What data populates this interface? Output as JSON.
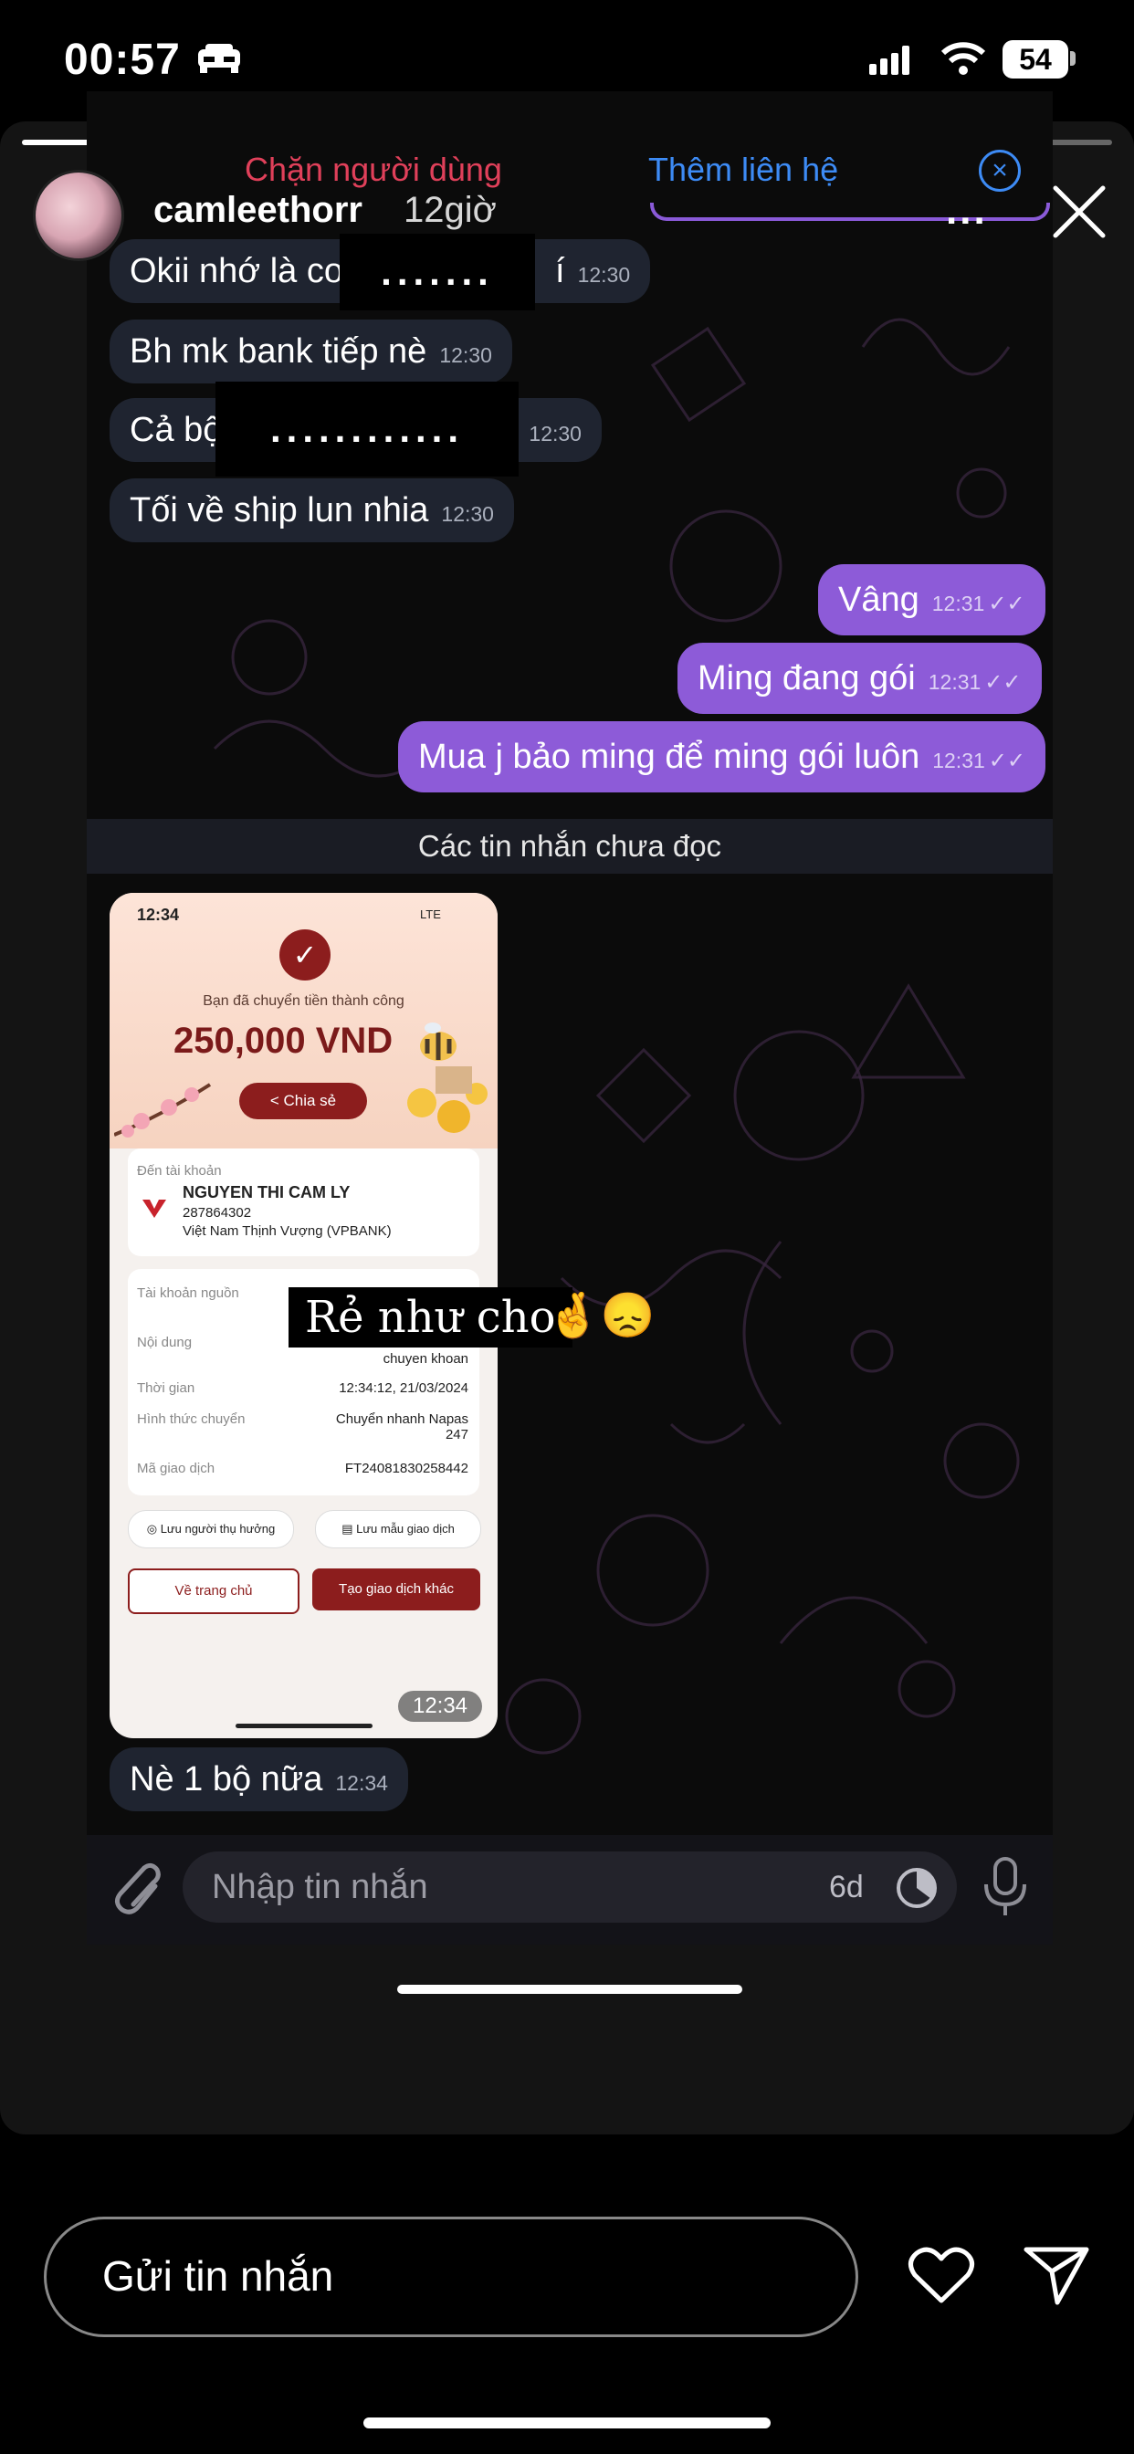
{
  "status_bar": {
    "time": "00:57",
    "battery": "54"
  },
  "story": {
    "username": "camleethorr",
    "age": "12giờ",
    "more_label": "...",
    "reply_placeholder": "Gửi tin nhắn"
  },
  "chat_header": {
    "block_user": "Chặn người dùng",
    "add_contact": "Thêm liên hệ"
  },
  "messages_in": [
    {
      "text": "Okii nhớ là co",
      "tail": "í",
      "time": "12:30",
      "redaction": "......."
    },
    {
      "text": "Bh mk bank tiếp nè",
      "time": "12:30"
    },
    {
      "text": "Cả bộ",
      "time": "12:30",
      "redaction": "............"
    },
    {
      "text": "Tối về ship lun nhia",
      "time": "12:30"
    }
  ],
  "messages_out": [
    {
      "text": "Vâng",
      "time": "12:31"
    },
    {
      "text": "Ming đang gói",
      "time": "12:31"
    },
    {
      "text": "Mua j bảo ming để ming gói luôn",
      "time": "12:31"
    }
  ],
  "unread_divider": "Các tin nhắn chưa đọc",
  "receipt": {
    "status_time": "12:34",
    "network": "LTE",
    "title": "Bạn đã chuyển tiền thành công",
    "amount": "250,000 VND",
    "share": "Chia sẻ",
    "dest_label": "Đến tài khoản",
    "dest_name": "NGUYEN THI CAM LY",
    "dest_account": "287864302",
    "dest_bank": "Việt Nam Thịnh Vượng (VPBANK)",
    "details": [
      {
        "label": "Tài khoản nguồn",
        "value": ""
      },
      {
        "label": "Nội dung",
        "value": "chuyen khoan"
      },
      {
        "label": "Thời gian",
        "value": "12:34:12, 21/03/2024"
      },
      {
        "label": "Hình thức chuyển",
        "value": "Chuyển nhanh Napas 247"
      },
      {
        "label": "Mã giao dịch",
        "value": "FT24081830258442"
      }
    ],
    "save_payee": "Lưu người thụ hưởng",
    "save_template": "Lưu mẫu giao dịch",
    "home": "Về trang chủ",
    "new_transaction": "Tạo giao dịch khác",
    "image_time": "12:34"
  },
  "sticker": {
    "text": "Rẻ như cho",
    "emoji": "🤞😞"
  },
  "last_message": {
    "text": "Nè 1 bộ nữa",
    "time": "12:34"
  },
  "composer": {
    "placeholder": "Nhập tin nhắn",
    "timer": "6d"
  },
  "colors": {
    "accent_purple": "#8d5bd8",
    "block_red": "#e0405a",
    "link_blue": "#3d8bf5",
    "vp_red": "#8c1d1d"
  }
}
